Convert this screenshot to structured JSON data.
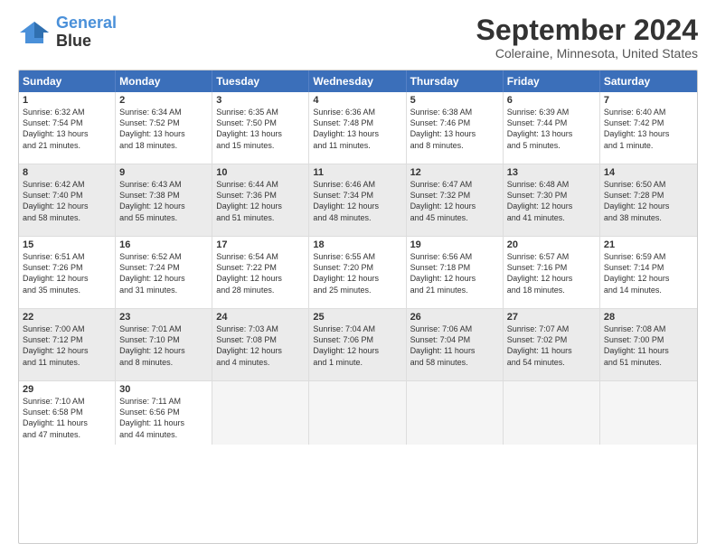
{
  "logo": {
    "line1": "General",
    "line2": "Blue"
  },
  "title": "September 2024",
  "subtitle": "Coleraine, Minnesota, United States",
  "header_days": [
    "Sunday",
    "Monday",
    "Tuesday",
    "Wednesday",
    "Thursday",
    "Friday",
    "Saturday"
  ],
  "rows": [
    [
      {
        "num": "1",
        "lines": [
          "Sunrise: 6:32 AM",
          "Sunset: 7:54 PM",
          "Daylight: 13 hours",
          "and 21 minutes."
        ],
        "shaded": false
      },
      {
        "num": "2",
        "lines": [
          "Sunrise: 6:34 AM",
          "Sunset: 7:52 PM",
          "Daylight: 13 hours",
          "and 18 minutes."
        ],
        "shaded": false
      },
      {
        "num": "3",
        "lines": [
          "Sunrise: 6:35 AM",
          "Sunset: 7:50 PM",
          "Daylight: 13 hours",
          "and 15 minutes."
        ],
        "shaded": false
      },
      {
        "num": "4",
        "lines": [
          "Sunrise: 6:36 AM",
          "Sunset: 7:48 PM",
          "Daylight: 13 hours",
          "and 11 minutes."
        ],
        "shaded": false
      },
      {
        "num": "5",
        "lines": [
          "Sunrise: 6:38 AM",
          "Sunset: 7:46 PM",
          "Daylight: 13 hours",
          "and 8 minutes."
        ],
        "shaded": false
      },
      {
        "num": "6",
        "lines": [
          "Sunrise: 6:39 AM",
          "Sunset: 7:44 PM",
          "Daylight: 13 hours",
          "and 5 minutes."
        ],
        "shaded": false
      },
      {
        "num": "7",
        "lines": [
          "Sunrise: 6:40 AM",
          "Sunset: 7:42 PM",
          "Daylight: 13 hours",
          "and 1 minute."
        ],
        "shaded": false
      }
    ],
    [
      {
        "num": "8",
        "lines": [
          "Sunrise: 6:42 AM",
          "Sunset: 7:40 PM",
          "Daylight: 12 hours",
          "and 58 minutes."
        ],
        "shaded": true
      },
      {
        "num": "9",
        "lines": [
          "Sunrise: 6:43 AM",
          "Sunset: 7:38 PM",
          "Daylight: 12 hours",
          "and 55 minutes."
        ],
        "shaded": true
      },
      {
        "num": "10",
        "lines": [
          "Sunrise: 6:44 AM",
          "Sunset: 7:36 PM",
          "Daylight: 12 hours",
          "and 51 minutes."
        ],
        "shaded": true
      },
      {
        "num": "11",
        "lines": [
          "Sunrise: 6:46 AM",
          "Sunset: 7:34 PM",
          "Daylight: 12 hours",
          "and 48 minutes."
        ],
        "shaded": true
      },
      {
        "num": "12",
        "lines": [
          "Sunrise: 6:47 AM",
          "Sunset: 7:32 PM",
          "Daylight: 12 hours",
          "and 45 minutes."
        ],
        "shaded": true
      },
      {
        "num": "13",
        "lines": [
          "Sunrise: 6:48 AM",
          "Sunset: 7:30 PM",
          "Daylight: 12 hours",
          "and 41 minutes."
        ],
        "shaded": true
      },
      {
        "num": "14",
        "lines": [
          "Sunrise: 6:50 AM",
          "Sunset: 7:28 PM",
          "Daylight: 12 hours",
          "and 38 minutes."
        ],
        "shaded": true
      }
    ],
    [
      {
        "num": "15",
        "lines": [
          "Sunrise: 6:51 AM",
          "Sunset: 7:26 PM",
          "Daylight: 12 hours",
          "and 35 minutes."
        ],
        "shaded": false
      },
      {
        "num": "16",
        "lines": [
          "Sunrise: 6:52 AM",
          "Sunset: 7:24 PM",
          "Daylight: 12 hours",
          "and 31 minutes."
        ],
        "shaded": false
      },
      {
        "num": "17",
        "lines": [
          "Sunrise: 6:54 AM",
          "Sunset: 7:22 PM",
          "Daylight: 12 hours",
          "and 28 minutes."
        ],
        "shaded": false
      },
      {
        "num": "18",
        "lines": [
          "Sunrise: 6:55 AM",
          "Sunset: 7:20 PM",
          "Daylight: 12 hours",
          "and 25 minutes."
        ],
        "shaded": false
      },
      {
        "num": "19",
        "lines": [
          "Sunrise: 6:56 AM",
          "Sunset: 7:18 PM",
          "Daylight: 12 hours",
          "and 21 minutes."
        ],
        "shaded": false
      },
      {
        "num": "20",
        "lines": [
          "Sunrise: 6:57 AM",
          "Sunset: 7:16 PM",
          "Daylight: 12 hours",
          "and 18 minutes."
        ],
        "shaded": false
      },
      {
        "num": "21",
        "lines": [
          "Sunrise: 6:59 AM",
          "Sunset: 7:14 PM",
          "Daylight: 12 hours",
          "and 14 minutes."
        ],
        "shaded": false
      }
    ],
    [
      {
        "num": "22",
        "lines": [
          "Sunrise: 7:00 AM",
          "Sunset: 7:12 PM",
          "Daylight: 12 hours",
          "and 11 minutes."
        ],
        "shaded": true
      },
      {
        "num": "23",
        "lines": [
          "Sunrise: 7:01 AM",
          "Sunset: 7:10 PM",
          "Daylight: 12 hours",
          "and 8 minutes."
        ],
        "shaded": true
      },
      {
        "num": "24",
        "lines": [
          "Sunrise: 7:03 AM",
          "Sunset: 7:08 PM",
          "Daylight: 12 hours",
          "and 4 minutes."
        ],
        "shaded": true
      },
      {
        "num": "25",
        "lines": [
          "Sunrise: 7:04 AM",
          "Sunset: 7:06 PM",
          "Daylight: 12 hours",
          "and 1 minute."
        ],
        "shaded": true
      },
      {
        "num": "26",
        "lines": [
          "Sunrise: 7:06 AM",
          "Sunset: 7:04 PM",
          "Daylight: 11 hours",
          "and 58 minutes."
        ],
        "shaded": true
      },
      {
        "num": "27",
        "lines": [
          "Sunrise: 7:07 AM",
          "Sunset: 7:02 PM",
          "Daylight: 11 hours",
          "and 54 minutes."
        ],
        "shaded": true
      },
      {
        "num": "28",
        "lines": [
          "Sunrise: 7:08 AM",
          "Sunset: 7:00 PM",
          "Daylight: 11 hours",
          "and 51 minutes."
        ],
        "shaded": true
      }
    ],
    [
      {
        "num": "29",
        "lines": [
          "Sunrise: 7:10 AM",
          "Sunset: 6:58 PM",
          "Daylight: 11 hours",
          "and 47 minutes."
        ],
        "shaded": false
      },
      {
        "num": "30",
        "lines": [
          "Sunrise: 7:11 AM",
          "Sunset: 6:56 PM",
          "Daylight: 11 hours",
          "and 44 minutes."
        ],
        "shaded": false
      },
      {
        "num": "",
        "lines": [],
        "shaded": false,
        "empty": true
      },
      {
        "num": "",
        "lines": [],
        "shaded": false,
        "empty": true
      },
      {
        "num": "",
        "lines": [],
        "shaded": false,
        "empty": true
      },
      {
        "num": "",
        "lines": [],
        "shaded": false,
        "empty": true
      },
      {
        "num": "",
        "lines": [],
        "shaded": false,
        "empty": true
      }
    ]
  ]
}
